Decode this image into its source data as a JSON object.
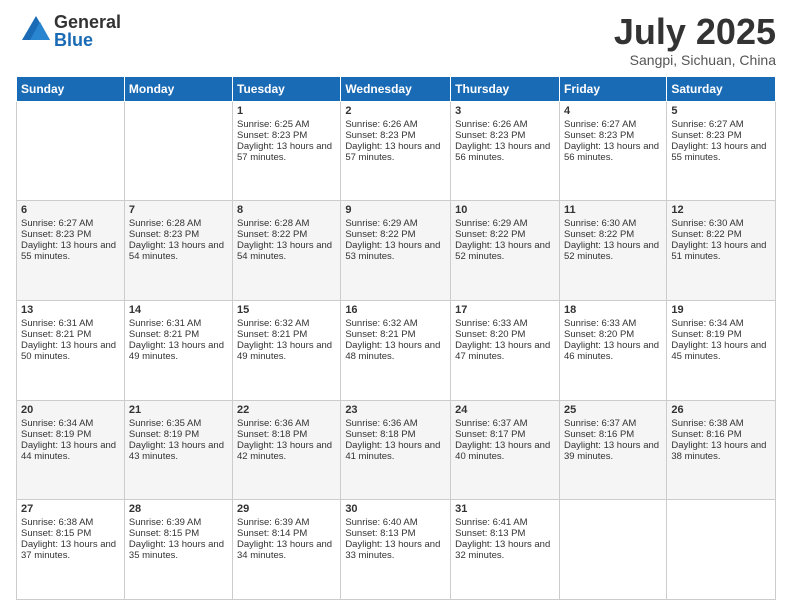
{
  "header": {
    "logo_general": "General",
    "logo_blue": "Blue",
    "month_title": "July 2025",
    "location": "Sangpi, Sichuan, China"
  },
  "weekdays": [
    "Sunday",
    "Monday",
    "Tuesday",
    "Wednesday",
    "Thursday",
    "Friday",
    "Saturday"
  ],
  "weeks": [
    [
      {
        "day": "",
        "sunrise": "",
        "sunset": "",
        "daylight": ""
      },
      {
        "day": "",
        "sunrise": "",
        "sunset": "",
        "daylight": ""
      },
      {
        "day": "1",
        "sunrise": "Sunrise: 6:25 AM",
        "sunset": "Sunset: 8:23 PM",
        "daylight": "Daylight: 13 hours and 57 minutes."
      },
      {
        "day": "2",
        "sunrise": "Sunrise: 6:26 AM",
        "sunset": "Sunset: 8:23 PM",
        "daylight": "Daylight: 13 hours and 57 minutes."
      },
      {
        "day": "3",
        "sunrise": "Sunrise: 6:26 AM",
        "sunset": "Sunset: 8:23 PM",
        "daylight": "Daylight: 13 hours and 56 minutes."
      },
      {
        "day": "4",
        "sunrise": "Sunrise: 6:27 AM",
        "sunset": "Sunset: 8:23 PM",
        "daylight": "Daylight: 13 hours and 56 minutes."
      },
      {
        "day": "5",
        "sunrise": "Sunrise: 6:27 AM",
        "sunset": "Sunset: 8:23 PM",
        "daylight": "Daylight: 13 hours and 55 minutes."
      }
    ],
    [
      {
        "day": "6",
        "sunrise": "Sunrise: 6:27 AM",
        "sunset": "Sunset: 8:23 PM",
        "daylight": "Daylight: 13 hours and 55 minutes."
      },
      {
        "day": "7",
        "sunrise": "Sunrise: 6:28 AM",
        "sunset": "Sunset: 8:23 PM",
        "daylight": "Daylight: 13 hours and 54 minutes."
      },
      {
        "day": "8",
        "sunrise": "Sunrise: 6:28 AM",
        "sunset": "Sunset: 8:22 PM",
        "daylight": "Daylight: 13 hours and 54 minutes."
      },
      {
        "day": "9",
        "sunrise": "Sunrise: 6:29 AM",
        "sunset": "Sunset: 8:22 PM",
        "daylight": "Daylight: 13 hours and 53 minutes."
      },
      {
        "day": "10",
        "sunrise": "Sunrise: 6:29 AM",
        "sunset": "Sunset: 8:22 PM",
        "daylight": "Daylight: 13 hours and 52 minutes."
      },
      {
        "day": "11",
        "sunrise": "Sunrise: 6:30 AM",
        "sunset": "Sunset: 8:22 PM",
        "daylight": "Daylight: 13 hours and 52 minutes."
      },
      {
        "day": "12",
        "sunrise": "Sunrise: 6:30 AM",
        "sunset": "Sunset: 8:22 PM",
        "daylight": "Daylight: 13 hours and 51 minutes."
      }
    ],
    [
      {
        "day": "13",
        "sunrise": "Sunrise: 6:31 AM",
        "sunset": "Sunset: 8:21 PM",
        "daylight": "Daylight: 13 hours and 50 minutes."
      },
      {
        "day": "14",
        "sunrise": "Sunrise: 6:31 AM",
        "sunset": "Sunset: 8:21 PM",
        "daylight": "Daylight: 13 hours and 49 minutes."
      },
      {
        "day": "15",
        "sunrise": "Sunrise: 6:32 AM",
        "sunset": "Sunset: 8:21 PM",
        "daylight": "Daylight: 13 hours and 49 minutes."
      },
      {
        "day": "16",
        "sunrise": "Sunrise: 6:32 AM",
        "sunset": "Sunset: 8:21 PM",
        "daylight": "Daylight: 13 hours and 48 minutes."
      },
      {
        "day": "17",
        "sunrise": "Sunrise: 6:33 AM",
        "sunset": "Sunset: 8:20 PM",
        "daylight": "Daylight: 13 hours and 47 minutes."
      },
      {
        "day": "18",
        "sunrise": "Sunrise: 6:33 AM",
        "sunset": "Sunset: 8:20 PM",
        "daylight": "Daylight: 13 hours and 46 minutes."
      },
      {
        "day": "19",
        "sunrise": "Sunrise: 6:34 AM",
        "sunset": "Sunset: 8:19 PM",
        "daylight": "Daylight: 13 hours and 45 minutes."
      }
    ],
    [
      {
        "day": "20",
        "sunrise": "Sunrise: 6:34 AM",
        "sunset": "Sunset: 8:19 PM",
        "daylight": "Daylight: 13 hours and 44 minutes."
      },
      {
        "day": "21",
        "sunrise": "Sunrise: 6:35 AM",
        "sunset": "Sunset: 8:19 PM",
        "daylight": "Daylight: 13 hours and 43 minutes."
      },
      {
        "day": "22",
        "sunrise": "Sunrise: 6:36 AM",
        "sunset": "Sunset: 8:18 PM",
        "daylight": "Daylight: 13 hours and 42 minutes."
      },
      {
        "day": "23",
        "sunrise": "Sunrise: 6:36 AM",
        "sunset": "Sunset: 8:18 PM",
        "daylight": "Daylight: 13 hours and 41 minutes."
      },
      {
        "day": "24",
        "sunrise": "Sunrise: 6:37 AM",
        "sunset": "Sunset: 8:17 PM",
        "daylight": "Daylight: 13 hours and 40 minutes."
      },
      {
        "day": "25",
        "sunrise": "Sunrise: 6:37 AM",
        "sunset": "Sunset: 8:16 PM",
        "daylight": "Daylight: 13 hours and 39 minutes."
      },
      {
        "day": "26",
        "sunrise": "Sunrise: 6:38 AM",
        "sunset": "Sunset: 8:16 PM",
        "daylight": "Daylight: 13 hours and 38 minutes."
      }
    ],
    [
      {
        "day": "27",
        "sunrise": "Sunrise: 6:38 AM",
        "sunset": "Sunset: 8:15 PM",
        "daylight": "Daylight: 13 hours and 37 minutes."
      },
      {
        "day": "28",
        "sunrise": "Sunrise: 6:39 AM",
        "sunset": "Sunset: 8:15 PM",
        "daylight": "Daylight: 13 hours and 35 minutes."
      },
      {
        "day": "29",
        "sunrise": "Sunrise: 6:39 AM",
        "sunset": "Sunset: 8:14 PM",
        "daylight": "Daylight: 13 hours and 34 minutes."
      },
      {
        "day": "30",
        "sunrise": "Sunrise: 6:40 AM",
        "sunset": "Sunset: 8:13 PM",
        "daylight": "Daylight: 13 hours and 33 minutes."
      },
      {
        "day": "31",
        "sunrise": "Sunrise: 6:41 AM",
        "sunset": "Sunset: 8:13 PM",
        "daylight": "Daylight: 13 hours and 32 minutes."
      },
      {
        "day": "",
        "sunrise": "",
        "sunset": "",
        "daylight": ""
      },
      {
        "day": "",
        "sunrise": "",
        "sunset": "",
        "daylight": ""
      }
    ]
  ]
}
